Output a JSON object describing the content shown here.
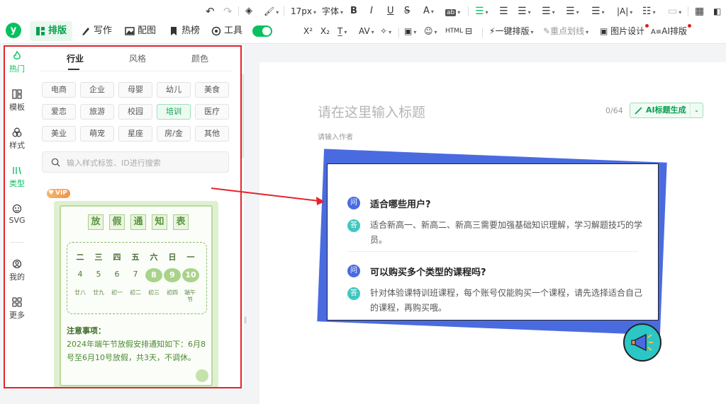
{
  "toolbar": {
    "row1": {
      "font_size": "17px",
      "font_family": "字体",
      "bold": "B",
      "italic": "I",
      "underline": "U",
      "strike": "S",
      "color": "A",
      "bg": "ab",
      "align_labels": [
        "≡",
        "≡",
        "≡",
        "≡",
        "≡",
        "≡",
        "|A|",
        "≡",
        "",
        "▦"
      ]
    },
    "logo": "y",
    "tabs": [
      {
        "label": "排版",
        "icon": "layout-icon",
        "active": true
      },
      {
        "label": "写作",
        "icon": "pen-icon",
        "active": false
      },
      {
        "label": "配图",
        "icon": "image-icon",
        "active": false
      },
      {
        "label": "热榜",
        "icon": "bookmark-icon",
        "active": false
      },
      {
        "label": "工具",
        "icon": "toolbox-icon",
        "active": false
      }
    ],
    "row2": {
      "superscript": "X²",
      "subscript": "X₂",
      "one_click_layout": "一键排版",
      "highlight": "重点划线",
      "image_design": "图片设计",
      "ai_layout": "AI排版"
    }
  },
  "rail": {
    "items": [
      {
        "label": "热门",
        "icon": "flame-icon",
        "active": true
      },
      {
        "label": "模板",
        "icon": "template-icon",
        "active": false
      },
      {
        "label": "样式",
        "icon": "style-icon",
        "active": false
      },
      {
        "label": "类型",
        "icon": "type-icon",
        "active": true
      },
      {
        "label": "SVG",
        "icon": "svg-icon",
        "active": false
      },
      {
        "label": "我的",
        "icon": "user-icon",
        "active": false
      },
      {
        "label": "更多",
        "icon": "grid-icon",
        "active": false
      }
    ]
  },
  "panel": {
    "tabs": [
      "行业",
      "风格",
      "颜色"
    ],
    "tags": [
      [
        "电商",
        "企业",
        "母婴",
        "幼儿",
        "美食"
      ],
      [
        "爱恋",
        "旅游",
        "校园",
        "培训",
        "医疗"
      ],
      [
        "美业",
        "萌宠",
        "星座",
        "房/金",
        "其他"
      ]
    ],
    "active_tag": "培训",
    "search_placeholder": "输入样式标签、ID进行搜索",
    "vip": "VIP",
    "card": {
      "title_chars": [
        "放",
        "假",
        "通",
        "知",
        "表"
      ],
      "weekdays": [
        "二",
        "三",
        "四",
        "五",
        "六",
        "日",
        "一"
      ],
      "dates": [
        "4",
        "5",
        "6",
        "7",
        "8",
        "9",
        "10"
      ],
      "lunar": [
        "廿八",
        "廿九",
        "初一",
        "初二",
        "初三",
        "初四",
        "端午节"
      ],
      "note_title": "注意事项：",
      "note_body": "2024年端午节放假安排通知如下：6月8号至6月10号放假，共3天，不调休。"
    }
  },
  "editor": {
    "title_placeholder": "请在这里输入标题",
    "counter": "0/64",
    "ai_button": "AI标题生成",
    "author_placeholder": "请输入作者",
    "qa": [
      {
        "badge_q": "问",
        "question": "适合哪些用户?",
        "badge_a": "答",
        "answer": "适合新高一、新高二、新高三需要加强基础知识理解，学习解题技巧的学员。"
      },
      {
        "badge_q": "问",
        "question": "可以购买多个类型的课程吗?",
        "badge_a": "答",
        "answer": "针对体验课特训班课程，每个账号仅能购买一个课程，请先选择适合自己的课程，再购买哦。"
      }
    ]
  },
  "colors": {
    "brand": "#07c160",
    "highlight_box": "#e5242a",
    "qa_blue": "#4a6be0",
    "qa_teal": "#40c8c0"
  }
}
